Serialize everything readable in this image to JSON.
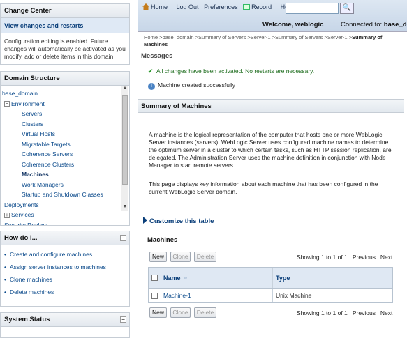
{
  "change_center": {
    "title": "Change Center",
    "link": "View changes and restarts",
    "text": "Configuration editing is enabled. Future changes will automatically be activated as you modify, add or delete items in this domain."
  },
  "domain_structure": {
    "title": "Domain Structure",
    "items": [
      {
        "label": "base_domain",
        "indent": 0,
        "expander": ""
      },
      {
        "label": "Environment",
        "indent": 1,
        "expander": "−"
      },
      {
        "label": "Servers",
        "indent": 2,
        "expander": ""
      },
      {
        "label": "Clusters",
        "indent": 2,
        "expander": ""
      },
      {
        "label": "Virtual Hosts",
        "indent": 2,
        "expander": ""
      },
      {
        "label": "Migratable Targets",
        "indent": 2,
        "expander": ""
      },
      {
        "label": "Coherence Servers",
        "indent": 2,
        "expander": ""
      },
      {
        "label": "Coherence Clusters",
        "indent": 2,
        "expander": ""
      },
      {
        "label": "Machines",
        "indent": 2,
        "expander": "",
        "selected": true
      },
      {
        "label": "Work Managers",
        "indent": 2,
        "expander": ""
      },
      {
        "label": "Startup and Shutdown Classes",
        "indent": 2,
        "expander": ""
      },
      {
        "label": "Deployments",
        "indent": 1,
        "expander": ""
      },
      {
        "label": "Services",
        "indent": 1,
        "expander": "+"
      },
      {
        "label": "Security Realms",
        "indent": 1,
        "expander": ""
      }
    ]
  },
  "how_do_i": {
    "title": "How do I...",
    "items": [
      "Create and configure machines",
      "Assign server instances to machines",
      "Clone machines",
      "Delete machines"
    ]
  },
  "system_status": {
    "title": "System Status"
  },
  "topnav": {
    "home": "Home",
    "logout": "Log Out",
    "preferences": "Preferences",
    "record": "Record",
    "help": "Help",
    "welcome": "Welcome, weblogic",
    "connected_label": "Connected to:",
    "connected_value": "base_domain"
  },
  "breadcrumb": {
    "path": "Home >base_domain >Summary of Servers >Server-1 >Summary of Servers >Server-1 >",
    "current": "Summary of Machines"
  },
  "messages": {
    "title": "Messages",
    "success": "All changes have been activated. No restarts are necessary.",
    "info": "Machine created successfully"
  },
  "summary": {
    "title": "Summary of Machines",
    "desc1": "A machine is the logical representation of the computer that hosts one or more WebLogic Server instances (servers). WebLogic Server uses configured machine names to determine the optimum server in a cluster to which certain tasks, such as HTTP session replication, are delegated. The Administration Server uses the machine definition in conjunction with Node Manager to start remote servers.",
    "desc2": "This page displays key information about each machine that has been configured in the current WebLogic Server domain.",
    "customize": "Customize this table"
  },
  "machines_table": {
    "title": "Machines",
    "buttons": {
      "new": "New",
      "clone": "Clone",
      "delete": "Delete"
    },
    "pager": {
      "showing": "Showing 1 to 1 of 1",
      "previous": "Previous",
      "sep": "|",
      "next": "Next"
    },
    "columns": {
      "name": "Name",
      "type": "Type"
    },
    "rows": [
      {
        "name": "Machine-1",
        "type": "Unix Machine"
      }
    ]
  }
}
